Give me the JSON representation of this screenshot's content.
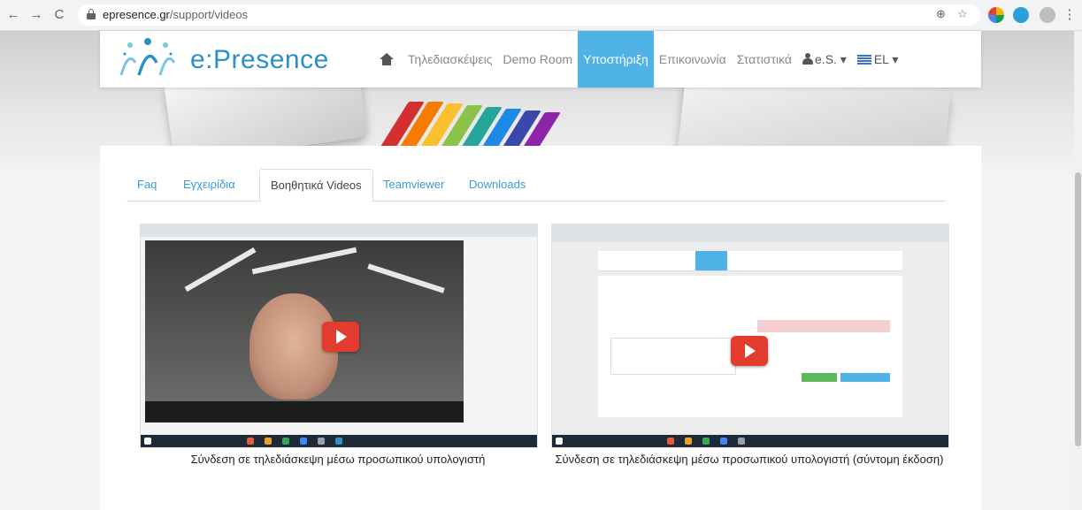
{
  "browser": {
    "url_domain": "epresence.gr",
    "url_path": "/support/videos",
    "back_glyph": "←",
    "forward_glyph": "→",
    "reload_glyph": "C",
    "zoom_glyph": "⊕",
    "star_glyph": "☆",
    "menu_glyph": "⋮"
  },
  "header": {
    "logo_text": "e:Presence",
    "nav": {
      "teleconferences": "Τηλεδιασκέψεις",
      "demo_room": "Demo Room",
      "support": "Υποστήριξη",
      "contact": "Επικοινωνία",
      "statistics": "Στατιστικά",
      "account": "e.S. ▾",
      "language": "EL ▾"
    }
  },
  "tabs": {
    "faq": "Faq",
    "manuals": "Εγχειρίδια",
    "videos": "Βοηθητικά Videos",
    "teamviewer": "Teamviewer",
    "downloads": "Downloads"
  },
  "videos": [
    {
      "caption": "Σύνδεση σε τηλεδιάσκεψη μέσω προσωπικού υπολογιστή"
    },
    {
      "caption": "Σύνδεση σε τηλεδιάσκεψη μέσω προσωπικού υπολογιστή (σύντομη έκδοση)"
    }
  ],
  "colors": {
    "brand": "#2d8fc6",
    "active_nav": "#4fb3e6",
    "tab_link": "#3a9ad9",
    "play": "#e33b2e"
  },
  "icons": [
    "back-icon",
    "forward-icon",
    "reload-icon",
    "lock-icon",
    "zoom-icon",
    "star-icon",
    "home-icon",
    "user-icon",
    "flag-icon",
    "play-icon"
  ]
}
